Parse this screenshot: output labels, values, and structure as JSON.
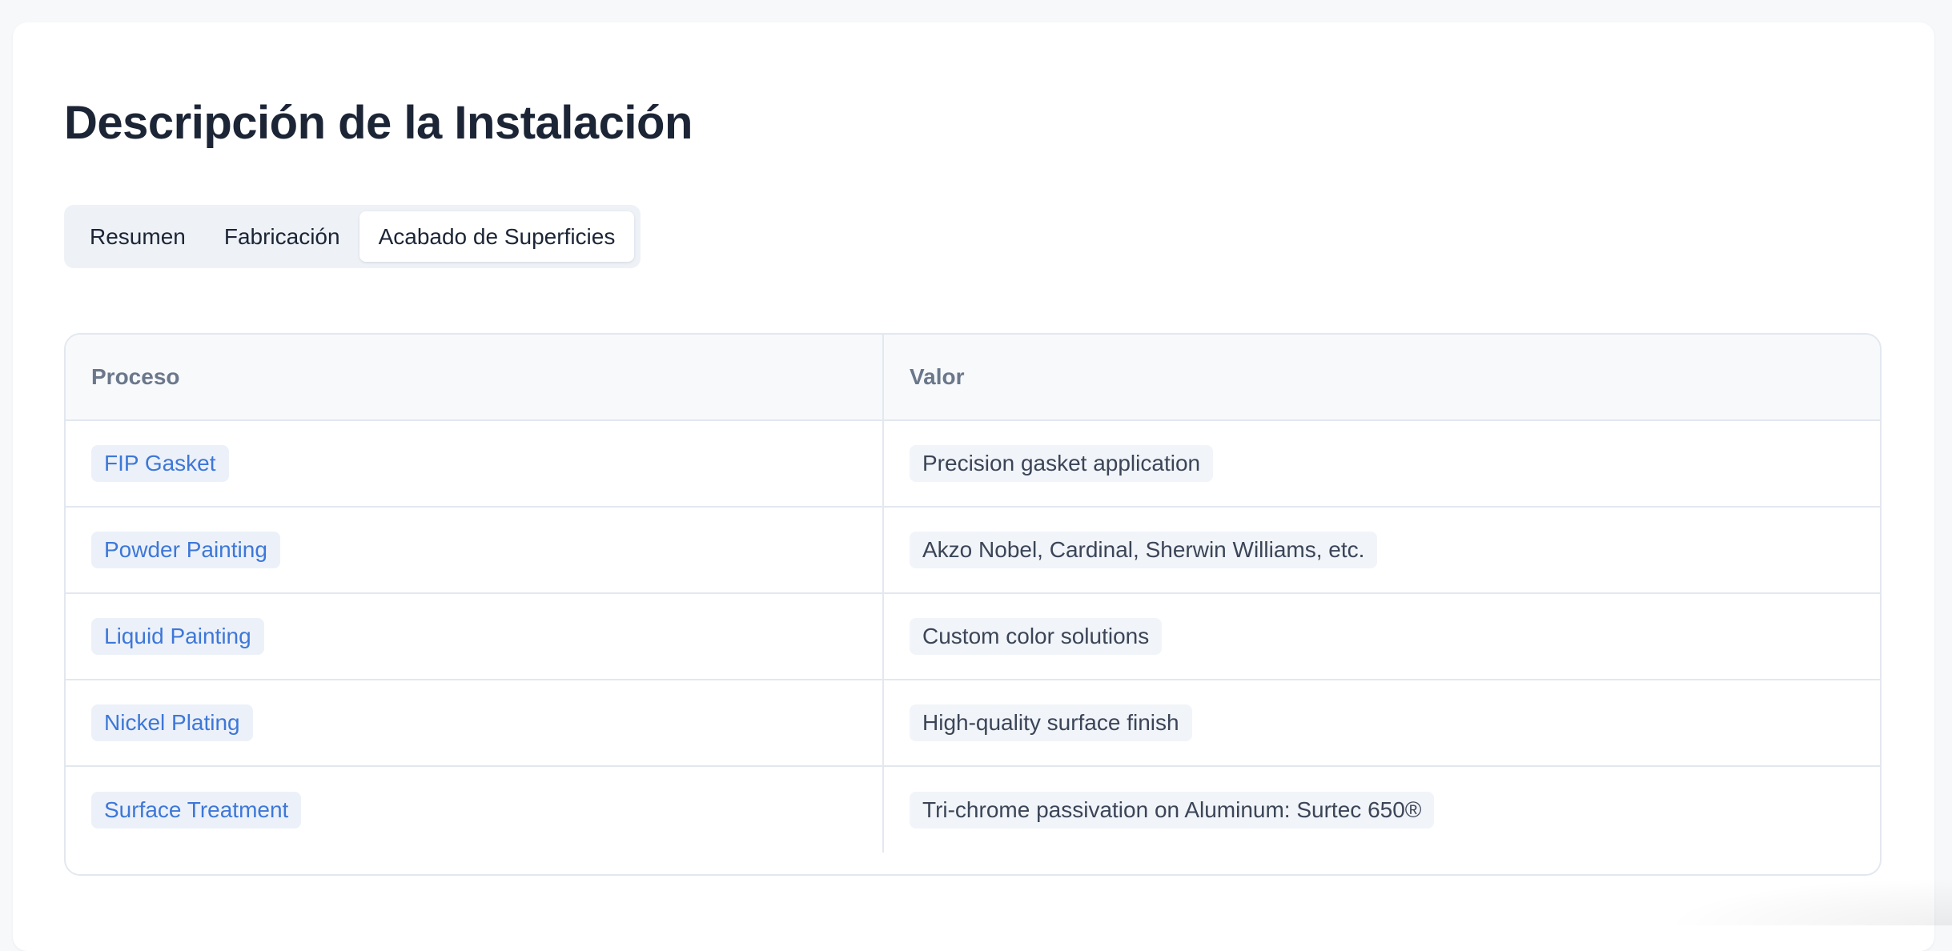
{
  "page": {
    "title": "Descripción de la Instalación"
  },
  "tabs": [
    {
      "label": "Resumen",
      "active": false
    },
    {
      "label": "Fabricación",
      "active": false
    },
    {
      "label": "Acabado de Superficies",
      "active": true
    }
  ],
  "table": {
    "headers": [
      "Proceso",
      "Valor"
    ],
    "rows": [
      {
        "process": "FIP Gasket",
        "value": "Precision gasket application"
      },
      {
        "process": "Powder Painting",
        "value": "Akzo Nobel, Cardinal, Sherwin Williams, etc."
      },
      {
        "process": "Liquid Painting",
        "value": "Custom color solutions"
      },
      {
        "process": "Nickel Plating",
        "value": "High-quality surface finish"
      },
      {
        "process": "Surface Treatment",
        "value": "Tri-chrome passivation on Aluminum: Surtec 650®"
      }
    ]
  },
  "colors": {
    "link": "#3d77d8",
    "title": "#1c2536",
    "tab_track": "#eef2f7",
    "border": "#e3e8ef"
  }
}
